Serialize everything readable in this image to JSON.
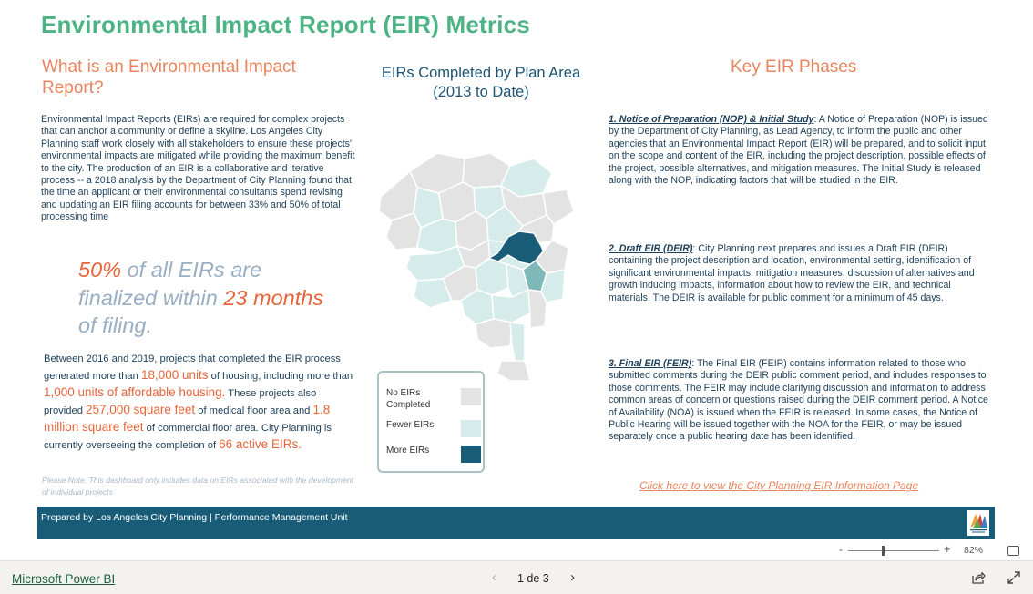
{
  "report": {
    "title": "Environmental Impact Report (EIR) Metrics",
    "what_heading": "What is an Environmental Impact Report?",
    "map_heading_line1": "EIRs Completed by Plan Area",
    "map_heading_line2": "(2013 to Date)",
    "key_heading": "Key EIR Phases",
    "intro": "Environmental Impact Reports (EIRs) are required for complex projects that can anchor a community or define a skyline. Los Angeles City Planning staff work closely with all stakeholders to ensure these projects' environmental impacts are mitigated while providing the maximum benefit to the city. The production of an EIR is a collaborative and iterative process -- a 2018 analysis by the Department of City Planning found that the time an applicant or their environmental consultants spend revising and updating an EIR filing accounts for between 33% and 50% of total processing time",
    "stat": {
      "pct": "50%",
      "t1": " of all EIRs are finalized within ",
      "months": "23 months",
      "t2": " of filing."
    },
    "housing": {
      "p1": "Between 2016 and 2019, projects that completed the EIR process generated more than ",
      "units": "18,000 units",
      "p2": " of housing, including more than ",
      "affordable": "1,000 units of affordable housing.",
      "p3": " These projects also provided ",
      "sqft": "257,000 square feet",
      "p4": " of medical floor area and ",
      "msqft": "1.8 million square feet",
      "p5": " of commercial floor area. City Planning is currently overseeing the completion of ",
      "active": "66 active EIRs."
    },
    "note": "Please Note: This dashboard only includes data on EIRs associated with the development of individual projects",
    "legend": {
      "none": "No EIRs Completed",
      "fewer": "Fewer EIRs",
      "more": "More EIRs",
      "colors": {
        "none": "#e3e3e3",
        "fewer": "#d6ecea",
        "more": "#195c77"
      }
    },
    "phases": [
      {
        "title": "1. Notice of Preparation (NOP) & Initial Study",
        "sep": ": ",
        "body": "A Notice of Preparation (NOP) is issued by the Department of City Planning, as Lead Agency, to inform the public and other agencies that an Environmental Impact Report (EIR) will be prepared, and to solicit input on the scope and content of the EIR, including the project description, possible effects of the project, possible alternatives, and mitigation measures. The Initial Study is released along with the NOP, indicating factors that will be studied in the EIR."
      },
      {
        "title": "2. Draft EIR (DEIR)",
        "sep": ":  ",
        "body": "City Planning next prepares and issues a Draft EIR (DEIR) containing the project description and location, environmental setting, identification of significant environmental impacts, mitigation measures, discussion of alternatives and growth inducing impacts, information about how to review the EIR, and technical materials. The DEIR is available for public comment for a minimum of 45 days."
      },
      {
        "title": "3. Final EIR (FEIR)",
        "sep": ": ",
        "body": "The Final EIR (FEIR) contains information related to those who submitted comments during the DEIR public comment period, and includes responses to those comments. The FEIR may include clarifying discussion and information to address common areas of concern or questions raised during the DEIR comment period. A Notice of Availability (NOA) is issued when the FEIR is released. In some cases, the Notice of Public Hearing will be issued together with the NOA for the FEIR, or may be issued separately once a public hearing date has been identified."
      }
    ],
    "link_text": "Click here to view the City Planning EIR Information Page",
    "footer": "Prepared by Los Angeles City Planning | Performance Management Unit"
  },
  "viewer": {
    "zoom_minus": "-",
    "zoom_plus": "+",
    "zoom_level": "82%",
    "zoom_fraction": 0.38,
    "brand": "Microsoft Power BI",
    "page_indicator": "1 de 3",
    "prev": "‹",
    "next": "›"
  }
}
